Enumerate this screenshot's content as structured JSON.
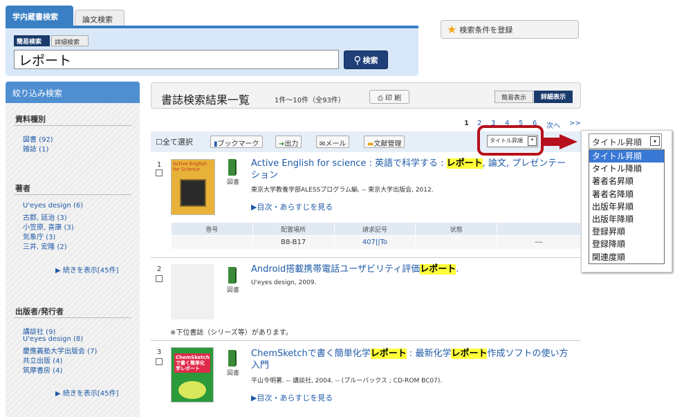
{
  "search": {
    "tab_local": "学内蔵書検索",
    "tab_articles": "論文検索",
    "mode_simple": "簡易検索",
    "mode_detail": "詳細検索",
    "query": "レポート",
    "search_button": "検索",
    "save_conditions": "検索条件を登録"
  },
  "sidebar": {
    "header": "絞り込み検索",
    "facets": [
      {
        "title": "資料種別",
        "items": [
          "図書 (92)",
          "雑誌 (1)"
        ]
      },
      {
        "title": "著者",
        "items": [
          "U'eyes design (6)",
          "古郡, 廷治 (3)",
          "小笠原, 喜康 (3)",
          "気象庁 (3)",
          "三井, 宏隆 (2)"
        ],
        "more": "▶ 続きを表示[45件]"
      },
      {
        "title": "出版者/発行者",
        "items": [
          "講談社 (9)",
          "U'eyes design (8)",
          "慶應義塾大学出版会 (7)",
          "共立出版 (4)",
          "筑摩書房 (4)"
        ],
        "more": "▶ 続きを表示[45件]"
      }
    ]
  },
  "results": {
    "title": "書誌検索結果一覧",
    "count": "1件～10件（全93件）",
    "print": "印 刷",
    "view_simple": "簡易表示",
    "view_detail": "詳細表示",
    "pager": {
      "current": "1",
      "pages": [
        "2",
        "3",
        "4",
        "5",
        "6"
      ],
      "next": "次へ",
      "last": ">>"
    },
    "toolbar": {
      "select_all": "全て選択",
      "bookmark": "ブックマーク",
      "export": "出力",
      "mail": "メール",
      "refmgr": "文献管理",
      "sort_current": "タイトル昇順"
    },
    "records": [
      {
        "num": "1",
        "title_a": "Active English for science : 英語で科学する : ",
        "title_hl": "レポート",
        "title_b": ", 論文, プレゼンテーション",
        "type": "図書",
        "meta": "東京大学教養学部ALESSプログラム編. -- 東京大学出版会, 2012.",
        "link": "▶目次・あらすじを見る",
        "cover_text": "Active English for Science",
        "holdings_headers": [
          "巻号",
          "配置場所",
          "請求記号",
          "状態",
          ""
        ],
        "holdings_row": [
          "",
          "B8-B17",
          "407||To",
          "",
          "---"
        ]
      },
      {
        "num": "2",
        "title_a": "Android搭載携帯電話ユーザビリティ評価",
        "title_hl": "レポート",
        "title_b": ".",
        "type": "図書",
        "meta": "U'eyes design, 2009.",
        "note": "※下位書誌（シリーズ等）があります。"
      },
      {
        "num": "3",
        "title_a": "ChemSketchで書く簡単化学",
        "title_hl": "レポート",
        "title_mid": " : 最新化学",
        "title_hl2": "レポート",
        "title_b": "作成ソフトの使い方入門",
        "type": "図書",
        "meta": "平山令明著. -- 講談社, 2004. -- (ブルーバックス ; CD-ROM BC07).",
        "link": "▶目次・あらすじを見る",
        "cover_text": "ChemSketchで書く簡単化学レポート"
      }
    ]
  },
  "sort_menu": {
    "selected": "タイトル昇順",
    "options": [
      "タイトル昇順",
      "タイトル降順",
      "著者名昇順",
      "著者名降順",
      "出版年昇順",
      "出版年降順",
      "登録昇順",
      "登録降順",
      "関連度順"
    ]
  },
  "colors": {
    "accent": "#3a7fc4",
    "highlight": "#ffff3a",
    "callout": "#b5101b",
    "selected_option": "#3a78d6"
  }
}
